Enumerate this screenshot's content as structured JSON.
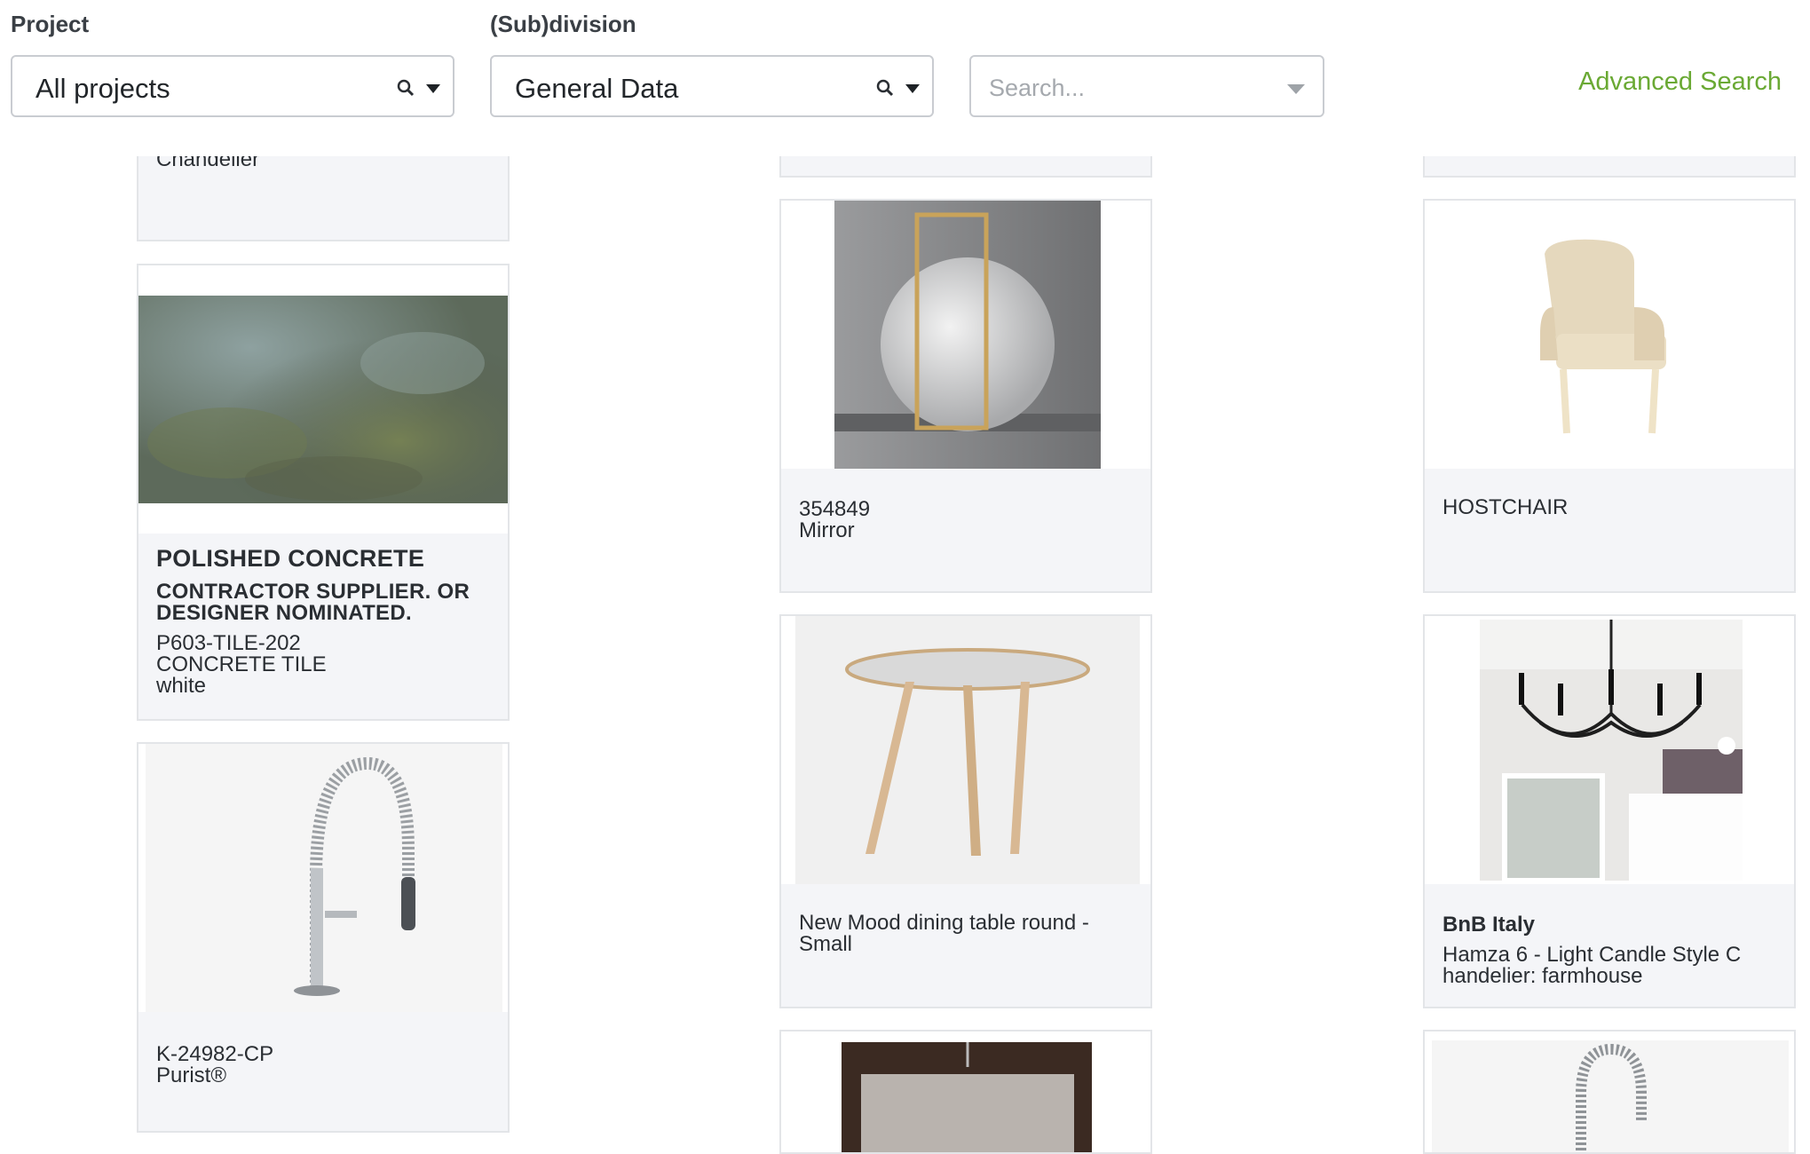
{
  "filters": {
    "project": {
      "label": "Project",
      "value": "All projects"
    },
    "subdivision": {
      "label": "(Sub)division",
      "value": "General Data"
    },
    "search": {
      "placeholder": "Search..."
    },
    "advanced_search": "Advanced Search"
  },
  "cards": {
    "chandelier_partial": {
      "line": "Chandelier"
    },
    "polished_concrete": {
      "title": "POLISHED CONCRETE",
      "subtitle": "CONTRACTOR SUPPLIER. OR DESIGNER NOMINATED.",
      "code": "P603-TILE-202",
      "name": "CONCRETE TILE",
      "color": "white"
    },
    "mirror": {
      "code": "354849",
      "name": "Mirror"
    },
    "hostchair": {
      "name": "HOSTCHAIR"
    },
    "dining_table": {
      "name": "New Mood dining table round - Small"
    },
    "hamza": {
      "brand": "BnB Italy",
      "name": "Hamza 6 - Light Candle Style C handelier: farmhouse"
    },
    "faucet": {
      "code": "K-24982-CP",
      "name": "Purist®"
    }
  },
  "colors": {
    "accent": "#6aa934",
    "card_bg": "#f4f5f8",
    "border": "#e3e5e8"
  },
  "icons": [
    "search-icon",
    "chevron-down-icon"
  ]
}
